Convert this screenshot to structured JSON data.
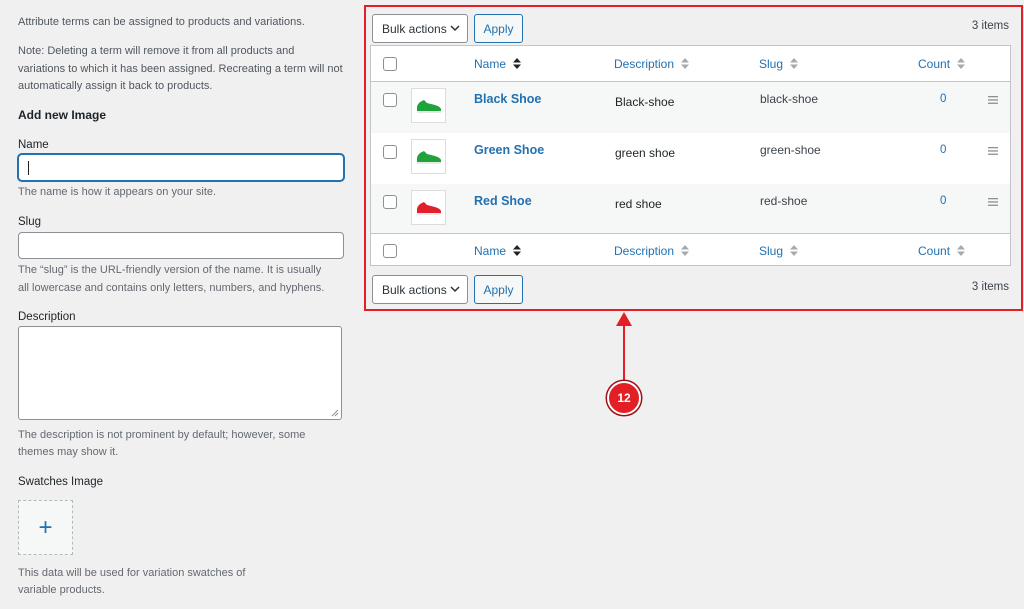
{
  "form": {
    "intro": "Attribute terms can be assigned to products and variations.",
    "note_line1": "Note: Deleting a term will remove it from all products and",
    "note_line2": "variations to which it has been assigned. Recreating a term will not",
    "note_line3": "automatically assign it back to products.",
    "heading": "Add new Image",
    "name_label": "Name",
    "name_value": "",
    "name_help": "The name is how it appears on your site.",
    "slug_label": "Slug",
    "slug_value": "",
    "slug_help_line1": "The “slug” is the URL-friendly version of the name. It is usually",
    "slug_help_line2": "all lowercase and contains only letters, numbers, and hyphens.",
    "description_label": "Description",
    "description_value": "",
    "description_help_line1": "The description is not prominent by default; however, some",
    "description_help_line2": "themes may show it.",
    "swatches_label": "Swatches Image",
    "upload_symbol": "+",
    "swatches_help_line1": "This data will be used for variation swatches of",
    "swatches_help_line2": "variable products."
  },
  "table": {
    "bulk_actions_label": "Bulk actions",
    "apply_label": "Apply",
    "items_count": "3 items",
    "columns": {
      "name": "Name",
      "description": "Description",
      "slug": "Slug",
      "count": "Count"
    },
    "rows": [
      {
        "name": "Black Shoe",
        "description": "Black-shoe",
        "slug": "black-shoe",
        "count": "0",
        "shoe_color": "#1fa33a"
      },
      {
        "name": "Green Shoe",
        "description": "green shoe",
        "slug": "green-shoe",
        "count": "0",
        "shoe_color": "#1fa33a"
      },
      {
        "name": "Red Shoe",
        "description": "red shoe",
        "slug": "red-shoe",
        "count": "0",
        "shoe_color": "#e0202a"
      }
    ],
    "drag_icon": "hamburger-icon"
  },
  "callout": {
    "number": "12",
    "color": "#e31f26"
  }
}
